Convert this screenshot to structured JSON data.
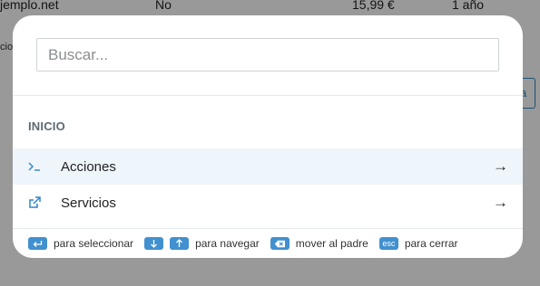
{
  "background": {
    "row": {
      "domain": "jemplo.net",
      "flag": "No",
      "price": "15,99 €",
      "period": "1 año"
    },
    "side_text": "cio",
    "edge_button": "a"
  },
  "search": {
    "placeholder": "Buscar...",
    "value": ""
  },
  "section": {
    "label": "INICIO"
  },
  "items": [
    {
      "label": "Acciones",
      "icon": "terminal-icon",
      "arrow": "→",
      "active": true
    },
    {
      "label": "Servicios",
      "icon": "external-link-icon",
      "arrow": "→",
      "active": false
    }
  ],
  "footer": {
    "select": "para seleccionar",
    "navigate": "para navegar",
    "parent": "mover al padre",
    "close": "para cerrar",
    "esc_key": "esc"
  },
  "colors": {
    "accent": "#2f86c7",
    "key_bg": "#4190cf",
    "active_row": "#eef5fb"
  }
}
